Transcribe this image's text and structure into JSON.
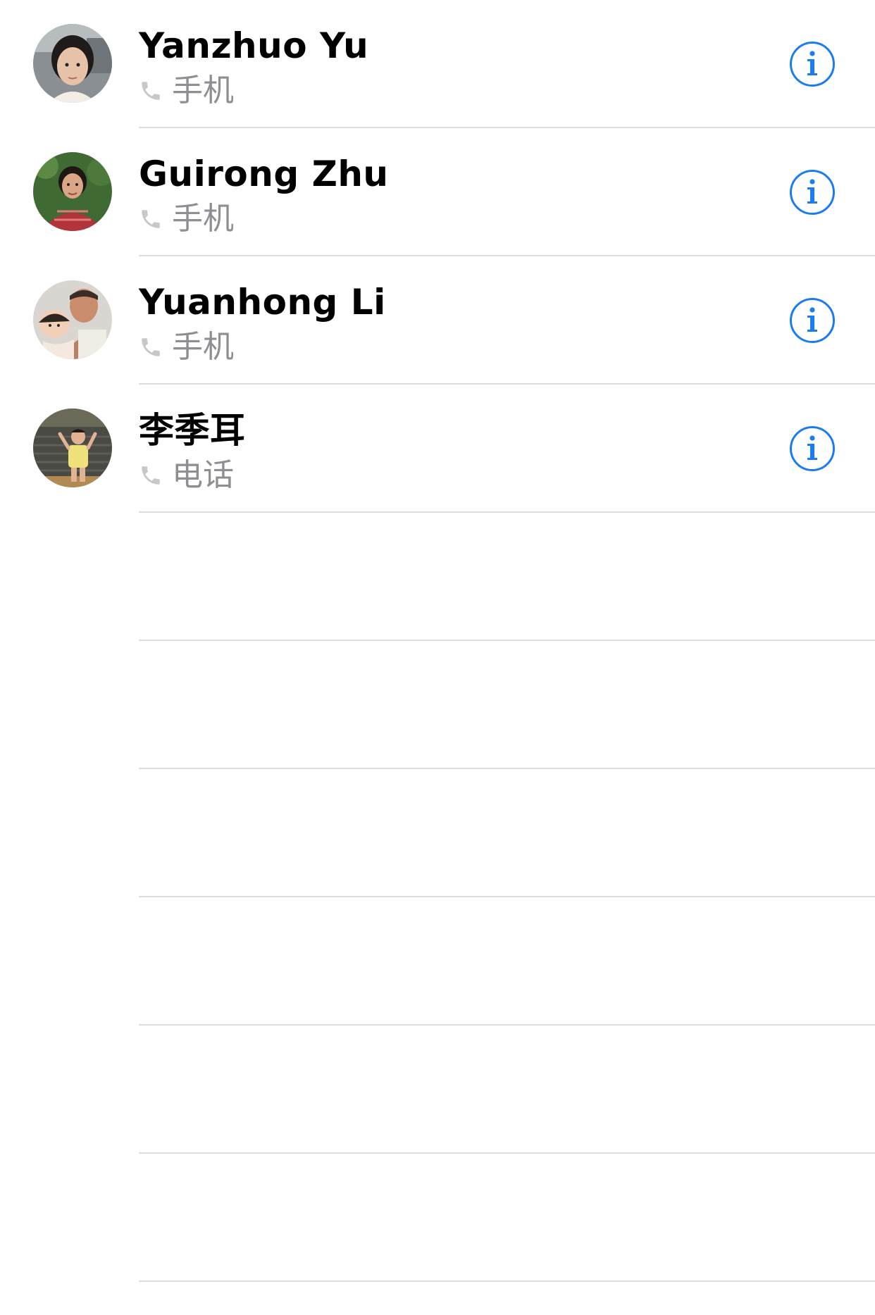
{
  "colors": {
    "accent": "#1a7cf0",
    "separator": "#dcdcdf",
    "secondary_text": "#8e8e93",
    "phone_icon": "#c7c7cc"
  },
  "contacts": [
    {
      "name": "Yanzhuo Yu",
      "label": "手机",
      "icon": "phone-icon",
      "action_icon": "info-icon"
    },
    {
      "name": "Guirong Zhu",
      "label": "手机",
      "icon": "phone-icon",
      "action_icon": "info-icon"
    },
    {
      "name": "Yuanhong Li",
      "label": "手机",
      "icon": "phone-icon",
      "action_icon": "info-icon"
    },
    {
      "name": "李季耳",
      "label": "电话",
      "icon": "phone-icon",
      "action_icon": "info-icon"
    }
  ]
}
